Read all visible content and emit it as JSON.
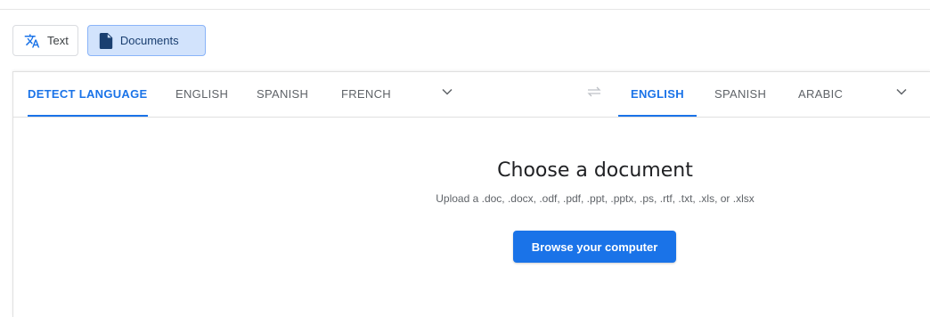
{
  "mode_tabs": {
    "text_label": "Text",
    "documents_label": "Documents"
  },
  "source_languages": {
    "detect": "DETECT LANGUAGE",
    "items": [
      "ENGLISH",
      "SPANISH",
      "FRENCH"
    ]
  },
  "target_languages": {
    "items": [
      "ENGLISH",
      "SPANISH",
      "ARABIC"
    ]
  },
  "upload": {
    "title": "Choose a document",
    "formats": "Upload a .doc, .docx, .odf, .pdf, .ppt, .pptx, .ps, .rtf, .txt, .xls, or .xlsx",
    "browse_label": "Browse your computer"
  },
  "icons": {
    "text_mode": "translate-icon",
    "documents_mode": "document-icon",
    "swap": "swap-languages-icon",
    "more": "chevron-down-icon"
  },
  "colors": {
    "accent": "#1a73e8",
    "active_mode_bg": "#d2e3fc"
  }
}
